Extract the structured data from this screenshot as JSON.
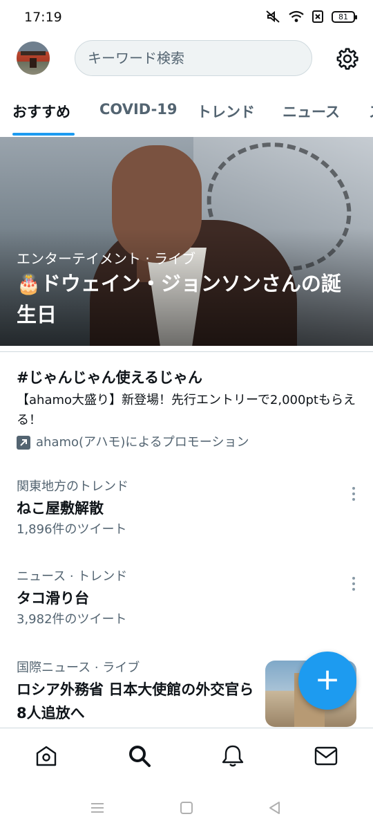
{
  "status_bar": {
    "time": "17:19",
    "battery": "81",
    "icons": [
      "mute-icon",
      "wifi-icon",
      "sim-icon",
      "battery-icon"
    ]
  },
  "header": {
    "search_placeholder": "キーワード検索",
    "settings_icon": "gear-icon"
  },
  "tabs": [
    {
      "label": "おすすめ",
      "active": true
    },
    {
      "label": "COVID-19",
      "active": false
    },
    {
      "label": "トレンド",
      "active": false
    },
    {
      "label": "ニュース",
      "active": false
    },
    {
      "label": "ス",
      "active": false
    }
  ],
  "hero": {
    "category": "エンターテイメント · ライブ",
    "emoji": "🎂",
    "title": "ドウェイン・ジョンソンさんの誕生日"
  },
  "promo": {
    "title": "#じゃんじゃん使えるじゃん",
    "description": "【ahamo大盛り】新登場！先行エントリーで2,000ptもらえる！",
    "promoted_by": "ahamo(アハモ)によるプロモーション"
  },
  "trends": [
    {
      "meta": "関東地方のトレンド",
      "title": "ねこ屋敷解散",
      "count": "1,896件のツイート"
    },
    {
      "meta": "ニュース · トレンド",
      "title": "タコ滑り台",
      "count": "3,982件のツイート"
    }
  ],
  "news": {
    "meta": "国際ニュース · ライブ",
    "title": "ロシア外務省 日本大使館の外交官ら8人追放へ"
  },
  "fab": {
    "label": "+"
  },
  "bottom_nav": [
    "home-icon",
    "search-icon",
    "notifications-icon",
    "messages-icon"
  ],
  "colors": {
    "accent": "#1d9bf0",
    "text": "#0f1419",
    "secondary": "#536471"
  }
}
